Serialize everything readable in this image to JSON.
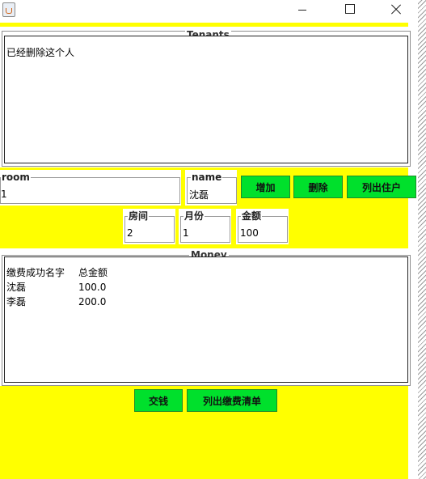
{
  "window": {
    "minimize_label": "",
    "maximize_label": "",
    "close_label": ""
  },
  "tenants_panel": {
    "title": "Tenants",
    "content": "已经删除这个人"
  },
  "room_field": {
    "label": "room",
    "value": "1"
  },
  "name_field": {
    "label": "name",
    "value": "沈磊"
  },
  "buttons": {
    "add": "增加",
    "delete": "删除",
    "list_tenants": "列出住户",
    "pay": "交钱",
    "list_payments": "列出缴费清单"
  },
  "room_no_field": {
    "label": "房间",
    "value": "2"
  },
  "month_field": {
    "label": "月份",
    "value": "1"
  },
  "amount_field": {
    "label": "金额",
    "value": "100"
  },
  "money_panel": {
    "title": "Money",
    "headers": [
      "缴费成功名字",
      "总金额"
    ],
    "rows": [
      [
        "沈磊",
        "100.0"
      ],
      [
        "李磊",
        "200.0"
      ]
    ]
  }
}
